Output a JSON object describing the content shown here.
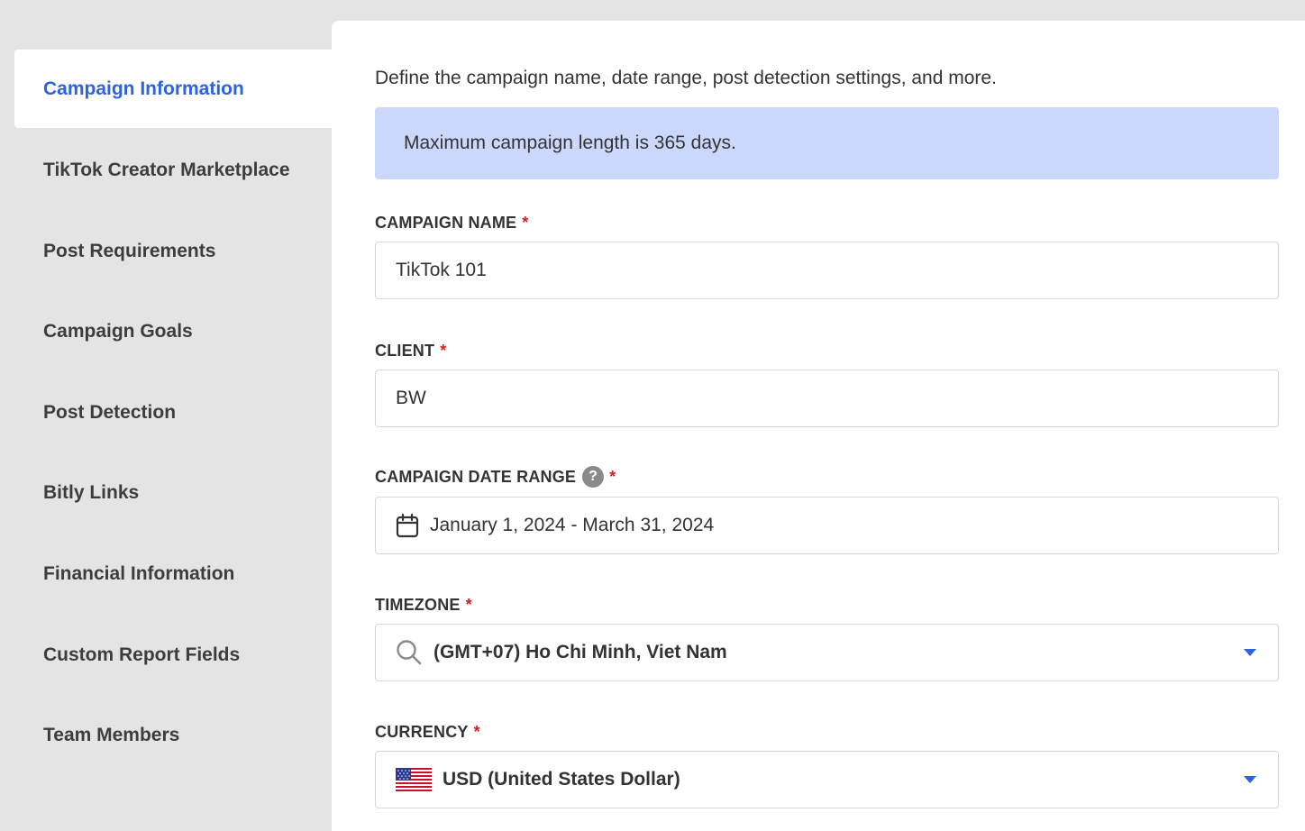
{
  "sidebar": {
    "items": [
      {
        "label": "Campaign Information",
        "active": true
      },
      {
        "label": "TikTok Creator Marketplace"
      },
      {
        "label": "Post Requirements"
      },
      {
        "label": "Campaign Goals"
      },
      {
        "label": "Post Detection"
      },
      {
        "label": "Bitly Links"
      },
      {
        "label": "Financial Information"
      },
      {
        "label": "Custom Report Fields"
      },
      {
        "label": "Team Members"
      }
    ]
  },
  "main": {
    "intro": "Define the campaign name, date range, post detection settings, and more.",
    "info_box": "Maximum campaign length is 365 days.",
    "required_marker": "*",
    "campaign_name": {
      "label": "CAMPAIGN NAME",
      "value": "TikTok 101"
    },
    "client": {
      "label": "CLIENT",
      "value": "BW"
    },
    "date_range": {
      "label": "CAMPAIGN DATE RANGE",
      "help_glyph": "?",
      "value": "January 1, 2024 - March 31, 2024",
      "icon": "calendar-icon"
    },
    "timezone": {
      "label": "TIMEZONE",
      "value": "(GMT+07) Ho Chi Minh, Viet Nam",
      "icon": "search-icon"
    },
    "currency": {
      "label": "CURRENCY",
      "value": "USD (United States Dollar)",
      "icon": "us-flag-icon"
    }
  },
  "colors": {
    "accent": "#2d62e0",
    "info_bg": "#ccd8fb",
    "required": "#d32020",
    "sidebar_bg": "#e4e4e4"
  }
}
